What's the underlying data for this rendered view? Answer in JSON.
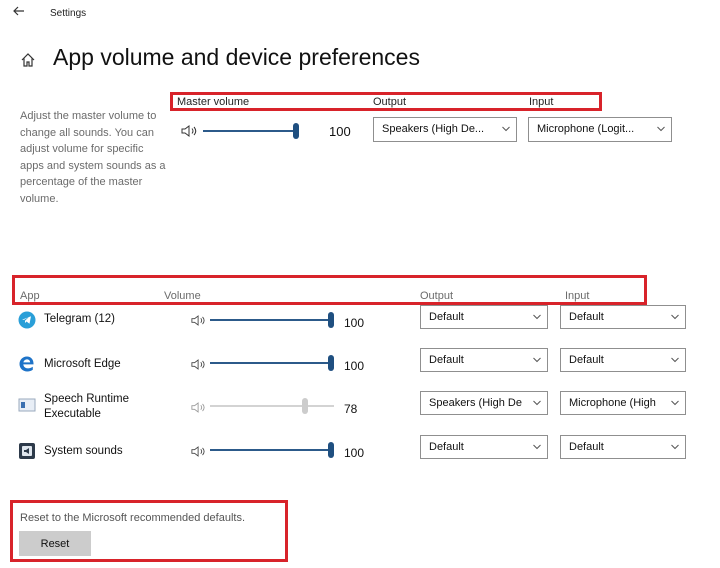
{
  "window": {
    "title": "Settings",
    "back_icon": "back-arrow-icon"
  },
  "page": {
    "title": "App volume and device preferences",
    "home_icon": "home-icon"
  },
  "master": {
    "description": "Adjust the master volume to change all sounds. You can adjust volume for specific apps and system sounds as a percentage of the master volume.",
    "header_volume": "Master volume",
    "header_output": "Output",
    "header_input": "Input",
    "volume": 100,
    "volume_label": "100",
    "output": "Speakers (High De...",
    "input": "Microphone (Logit..."
  },
  "apps_header": {
    "app": "App",
    "volume": "Volume",
    "output": "Output",
    "input": "Input"
  },
  "apps": [
    {
      "name": "Telegram (12)",
      "icon": "telegram-icon",
      "volume": 100,
      "volume_label": "100",
      "output": "Default",
      "input": "Default",
      "dimmed": false
    },
    {
      "name": "Microsoft Edge",
      "icon": "edge-icon",
      "volume": 100,
      "volume_label": "100",
      "output": "Default",
      "input": "Default",
      "dimmed": false
    },
    {
      "name": "Speech Runtime Executable",
      "icon": "speech-runtime-icon",
      "volume": 78,
      "volume_label": "78",
      "output": "Speakers (High De",
      "input": "Microphone (High",
      "dimmed": true
    },
    {
      "name": "System sounds",
      "icon": "system-sounds-icon",
      "volume": 100,
      "volume_label": "100",
      "output": "Default",
      "input": "Default",
      "dimmed": false
    }
  ],
  "reset": {
    "text": "Reset to the Microsoft recommended defaults.",
    "button_label": "Reset"
  },
  "colors": {
    "highlight_box": "#d8232a",
    "slider": "#1f4f80",
    "slider_dim": "#cccccc",
    "button_bg": "#cccccc"
  }
}
